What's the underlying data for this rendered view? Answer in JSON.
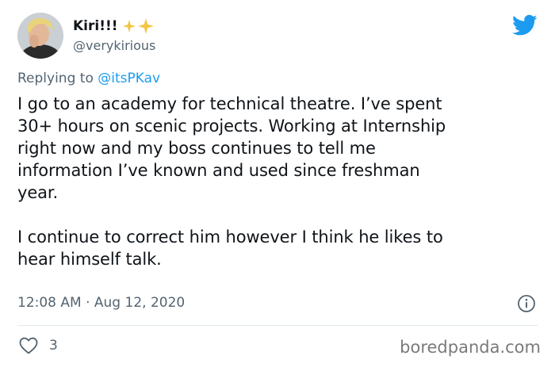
{
  "author": {
    "display_name": "Kiri!!!",
    "handle": "@verykirious",
    "avatar_icon": "avatar-photo",
    "name_emoji_icon": "sparkles-icon"
  },
  "reply": {
    "prefix": "Replying to ",
    "mention": "@itsPKav"
  },
  "tweet": {
    "paragraphs": [
      "I go to an academy for technical theatre. I’ve spent\n30+ hours on scenic projects.  Working at Internship\nright now and my boss continues to tell me\ninformation I’ve known and used since freshman\nyear.",
      "I continue to correct him however I think he likes to\nhear himself talk."
    ],
    "timestamp": "12:08 AM · Aug 12, 2020",
    "like_count": "3"
  },
  "icons": {
    "brand": "twitter-bird-icon",
    "info": "info-icon",
    "like": "heart-icon"
  },
  "watermark": "boredpanda.com",
  "colors": {
    "brand_blue": "#1d9bf0",
    "secondary_text": "#536471",
    "sparkle_gold": "#f4c542"
  }
}
